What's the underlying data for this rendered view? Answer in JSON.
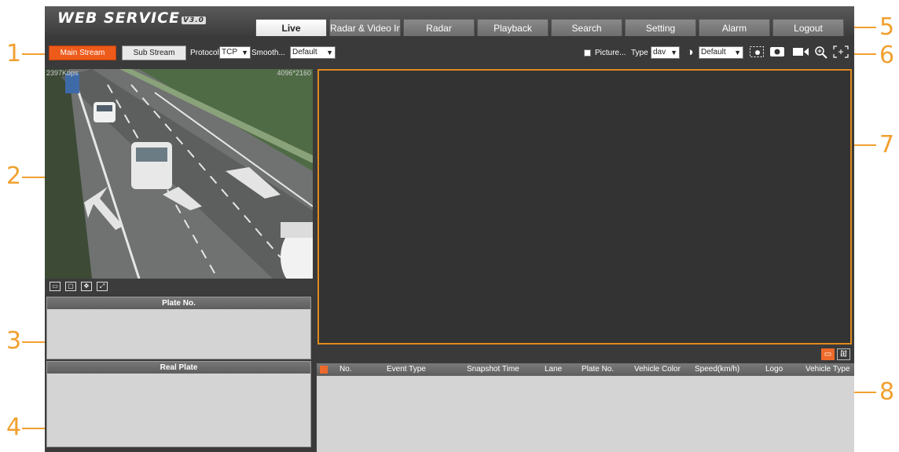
{
  "app": {
    "logo": "WEB SERVICE",
    "version": "V3.0"
  },
  "tabs": [
    {
      "label": "Live"
    },
    {
      "label": "Radar & Video Int"
    },
    {
      "label": "Radar"
    },
    {
      "label": "Playback"
    },
    {
      "label": "Search"
    },
    {
      "label": "Setting"
    },
    {
      "label": "Alarm"
    },
    {
      "label": "Logout"
    }
  ],
  "toolbar": {
    "main_stream": "Main Stream",
    "sub_stream": "Sub Stream",
    "protocol_label": "Protocol",
    "protocol_value": "TCP",
    "smooth_label": "Smooth...",
    "smooth_value": "Default",
    "picture_label": "Picture...",
    "type_label": "Type",
    "type_value": "dav",
    "quality_value": "Default",
    "icons": [
      "brightness-icon",
      "snapshot-region-icon",
      "record-icon",
      "video-icon",
      "zoom-icon",
      "fullscreen-icon"
    ]
  },
  "video_left": {
    "bitrate": "2397Kbps",
    "resolution": "4096*2160"
  },
  "panels": {
    "plate_title": "Plate No.",
    "real_plate_title": "Real Plate"
  },
  "table": {
    "columns": [
      "No.",
      "Event Type",
      "Snapshot Time",
      "Lane",
      "Plate No.",
      "Vehicle Color",
      "Speed(km/h)",
      "Logo",
      "Vehicle Type"
    ]
  },
  "callouts": [
    "1",
    "2",
    "3",
    "4",
    "5",
    "6",
    "7",
    "8"
  ],
  "colors": {
    "accent": "#e08a1e",
    "callout": "#f0a030",
    "button_active": "#ee5a1a"
  }
}
